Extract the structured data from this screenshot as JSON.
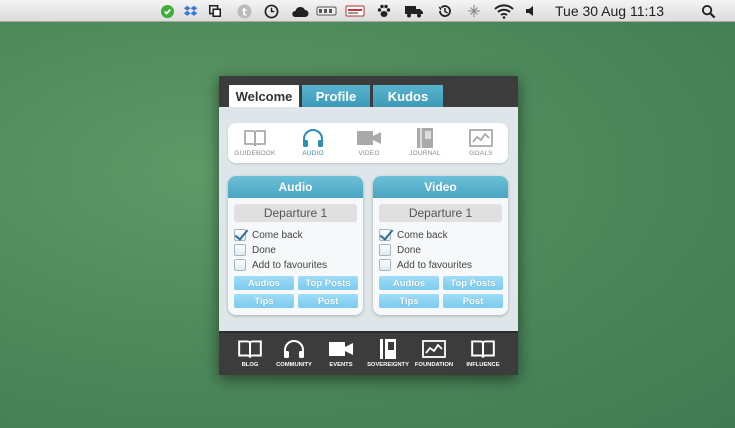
{
  "menubar": {
    "clock": "Tue 30 Aug  11:13",
    "icons": [
      "evernote-icon",
      "dropbox-icon",
      "crop-icon",
      "twitter-icon",
      "clock-icon",
      "cloud-icon",
      "battery-meter-icon",
      "mail-icon",
      "paw-icon",
      "truck-icon",
      "time-machine-icon",
      "bluetooth-icon",
      "wifi-icon",
      "volume-icon",
      "spotlight-icon"
    ]
  },
  "widget": {
    "tabs": [
      "Welcome",
      "Profile",
      "Kudos"
    ],
    "active_tab": "Welcome",
    "media": [
      {
        "label": "GUIDEBOOK",
        "icon": "book-icon"
      },
      {
        "label": "AUDIO",
        "icon": "headphones-icon",
        "active": true
      },
      {
        "label": "VIDEO",
        "icon": "video-camera-icon"
      },
      {
        "label": "JOURNAL",
        "icon": "journal-icon"
      },
      {
        "label": "GOALS",
        "icon": "chart-icon"
      }
    ],
    "panels": [
      {
        "title": "Audio",
        "episode": "Departure 1",
        "options": [
          {
            "label": "Come back",
            "checked": true
          },
          {
            "label": "Done",
            "checked": false
          },
          {
            "label": "Add to favourites",
            "checked": false
          }
        ],
        "buttons": [
          "Audios",
          "Top Posts",
          "Tips",
          "Post"
        ]
      },
      {
        "title": "Video",
        "episode": "Departure 1",
        "options": [
          {
            "label": "Come back",
            "checked": true
          },
          {
            "label": "Done",
            "checked": false
          },
          {
            "label": "Add to favourites",
            "checked": false
          }
        ],
        "buttons": [
          "Audios",
          "Top Posts",
          "Tips",
          "Post"
        ]
      }
    ],
    "nav": [
      {
        "label": "BLOG",
        "icon": "book-icon"
      },
      {
        "label": "COMMUNITY",
        "icon": "headphones-icon"
      },
      {
        "label": "EVENTS",
        "icon": "video-camera-icon"
      },
      {
        "label": "SOVEREIGNTY",
        "icon": "journal-icon"
      },
      {
        "label": "FOUNDATION",
        "icon": "chart-icon"
      },
      {
        "label": "INFLUENCE",
        "icon": "book-icon"
      }
    ]
  },
  "colors": {
    "accent": "#4aa5c2",
    "button": "#7ccbef",
    "dark_bar": "#3c3c3c",
    "desktop": "#4f8a5c"
  }
}
